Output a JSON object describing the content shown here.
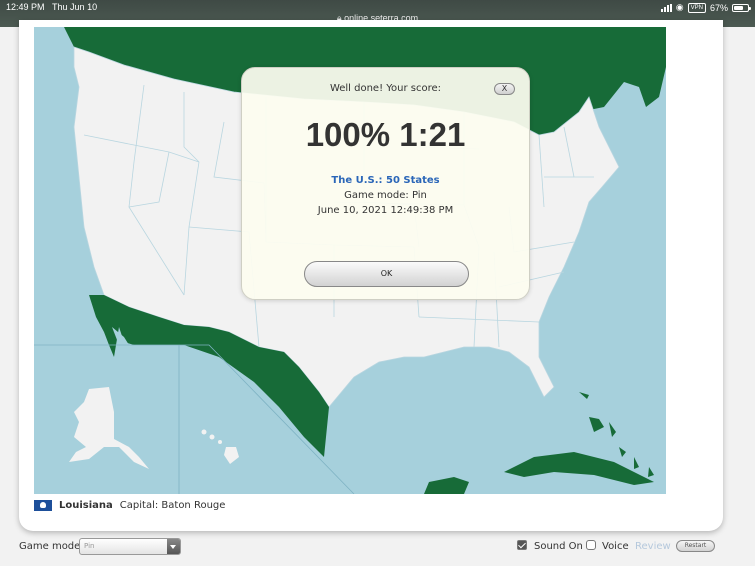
{
  "status_bar": {
    "time": "12:49 PM",
    "date": "Thu Jun 10",
    "url": "online.seterra.com",
    "vpn_label": "VPN",
    "battery": "67%",
    "battery_level": 0.67
  },
  "dialog": {
    "heading": "Well done! Your score:",
    "close_label": "X",
    "score": "100% 1:21",
    "score_percent": 100,
    "time_taken": "1:21",
    "quiz_title": "The U.S.: 50 States",
    "game_mode_line": "Game mode: Pin",
    "datetime": "June 10, 2021  12:49:38 PM",
    "ok_label": "OK"
  },
  "info_bar": {
    "flag_icon": "louisiana-flag",
    "state": "Louisiana",
    "capital": "Capital: Baton Rouge"
  },
  "footer": {
    "game_mode_label": "Game mode:",
    "game_mode_value": "Pin",
    "sound_label": "Sound On",
    "sound_checked": true,
    "voice_label": "Voice",
    "voice_checked": false,
    "review_label": "Review",
    "restart_label": "Restart"
  },
  "colors": {
    "water": "#a6d0dc",
    "land_us": "#f2f2f2",
    "land_other": "#176b38",
    "state_border": "#b9d6e0",
    "accent_link": "#2a66b8"
  }
}
